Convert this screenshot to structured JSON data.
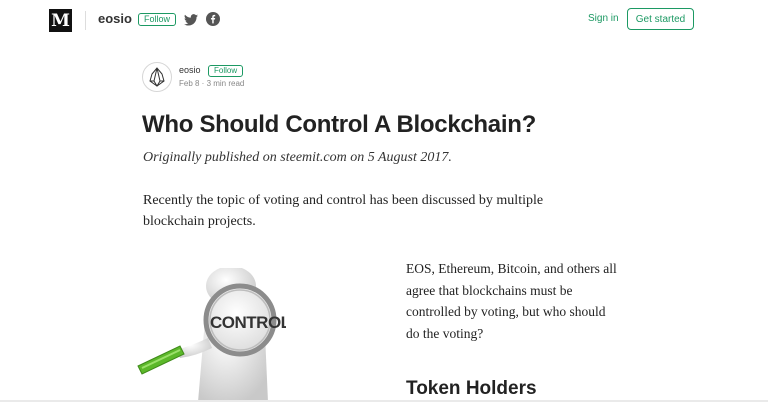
{
  "nav": {
    "logo": "M",
    "publication": "eosio",
    "follow_label": "Follow",
    "twitter_icon": "twitter-icon",
    "facebook_icon": "facebook-icon",
    "signin_label": "Sign in",
    "get_started_label": "Get started"
  },
  "author": {
    "avatar_icon": "eos-logo-icon",
    "name": "eosio",
    "follow_label": "Follow",
    "meta": "Feb 8 · 3 min read"
  },
  "article": {
    "title": "Who Should Control A Blockchain?",
    "subtitle": "Originally published on steemit.com on 5 August 2017.",
    "paragraph_1": "Recently the topic of voting and control has been discussed by multiple blockchain projects.",
    "side_paragraph": "EOS, Ethereum, Bitcoin, and others all agree that blockchains must be controlled by voting, but who should do the voting?",
    "heading_2": "Token Holders",
    "image_text": "CONTROL"
  },
  "colors": {
    "accent": "#1c9963",
    "text": "#222222"
  }
}
